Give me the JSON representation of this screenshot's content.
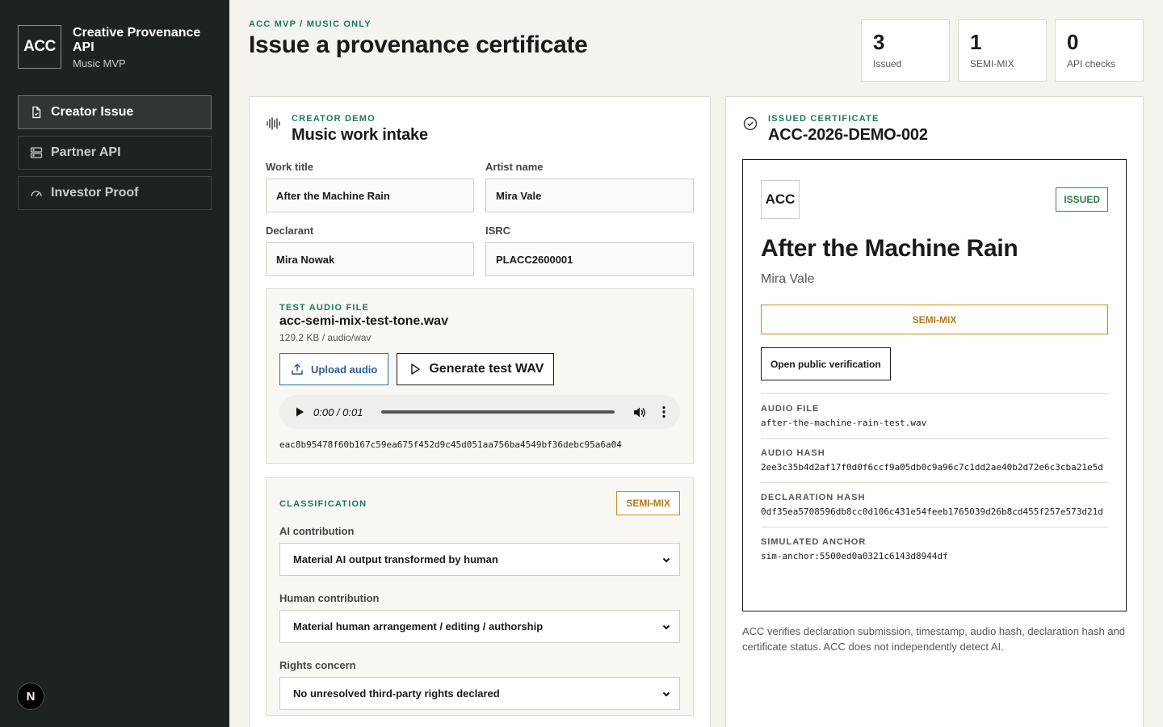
{
  "brand": {
    "logo": "ACC",
    "title": "Creative Provenance API",
    "subtitle": "Music MVP"
  },
  "nav": [
    {
      "label": "Creator Issue",
      "icon": "document-icon",
      "active": true
    },
    {
      "label": "Partner API",
      "icon": "server-icon",
      "active": false
    },
    {
      "label": "Investor Proof",
      "icon": "gauge-icon",
      "active": false
    }
  ],
  "corner_badge": "N",
  "header": {
    "eyebrow": "ACC MVP / MUSIC ONLY",
    "title": "Issue a provenance certificate"
  },
  "stats": [
    {
      "value": "3",
      "label": "Issued"
    },
    {
      "value": "1",
      "label": "SEMI-MIX"
    },
    {
      "value": "0",
      "label": "API checks"
    }
  ],
  "intake": {
    "eyebrow": "CREATOR DEMO",
    "title": "Music work intake",
    "fields": {
      "work_title": {
        "label": "Work title",
        "value": "After the Machine Rain"
      },
      "artist_name": {
        "label": "Artist name",
        "value": "Mira Vale"
      },
      "declarant": {
        "label": "Declarant",
        "value": "Mira Nowak"
      },
      "isrc": {
        "label": "ISRC",
        "value": "PLACC2600001"
      }
    },
    "audio": {
      "eyebrow": "TEST AUDIO FILE",
      "file_name": "acc-semi-mix-test-tone.wav",
      "file_meta": "129.2 KB / audio/wav",
      "upload_label": "Upload audio",
      "generate_label": "Generate test WAV",
      "player_time": "0:00 / 0:01",
      "hash": "eac8b95478f60b167c59ea675f452d9c45d051aa756ba4549bf36debc95a6a04"
    },
    "classification": {
      "eyebrow": "CLASSIFICATION",
      "badge": "SEMI-MIX",
      "ai_label": "AI contribution",
      "ai_value": "Material AI output transformed by human",
      "human_label": "Human contribution",
      "human_value": "Material human arrangement / editing / authorship",
      "rights_label": "Rights concern",
      "rights_value": "No unresolved third-party rights declared"
    }
  },
  "certificate": {
    "eyebrow": "ISSUED CERTIFICATE",
    "id": "ACC-2026-DEMO-002",
    "logo": "ACC",
    "status": "ISSUED",
    "title": "After the Machine Rain",
    "artist": "Mira Vale",
    "classification": "SEMI-MIX",
    "verify_label": "Open public verification",
    "audio_file_label": "AUDIO FILE",
    "audio_file": "after-the-machine-rain-test.wav",
    "audio_hash_label": "AUDIO HASH",
    "audio_hash": "2ee3c35b4d2af17f0d0f6ccf9a05db0c9a96c7c1dd2ae40b2d72e6c3cba21e5d",
    "declaration_hash_label": "DECLARATION HASH",
    "declaration_hash": "0df35ea5708596db8cc0d106c431e54feeb1765039d26b8cd455f257e573d21d",
    "anchor_label": "SIMULATED ANCHOR",
    "anchor": "sim-anchor:5500ed0a0321c6143d8944df",
    "disclaimer": "ACC verifies declaration submission, timestamp, audio hash, declaration hash and certificate status. ACC does not independently detect AI."
  },
  "colors": {
    "sidebar": "#1d2321",
    "accent": "#1a7a5e",
    "semi_mix": "#b6791a",
    "issued": "#2a7f44",
    "upload": "#2b5e92"
  }
}
